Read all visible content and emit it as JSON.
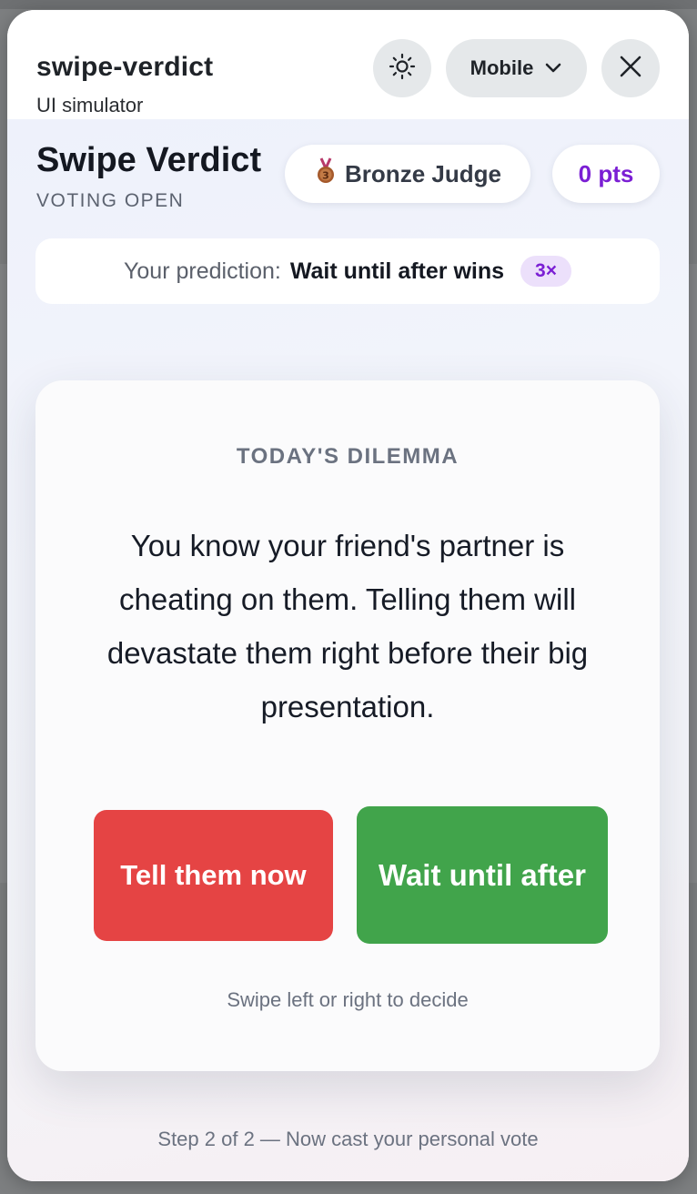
{
  "simulator": {
    "title": "swipe-verdict",
    "subtitle": "UI simulator",
    "device_label": "Mobile",
    "theme_icon": "sun-icon",
    "close_icon": "close-icon"
  },
  "app": {
    "title": "Swipe Verdict",
    "status": "VOTING OPEN",
    "rank": {
      "icon": "bronze-medal-icon",
      "label": "Bronze Judge"
    },
    "points": "0 pts",
    "prediction": {
      "prefix": "Your prediction:",
      "value": "Wait until after wins",
      "multiplier": "3×"
    },
    "card": {
      "label": "TODAY'S DILEMMA",
      "text": "You know your friend's partner is cheating on them. Telling them will devastate them right before their big presentation.",
      "option_left": "Tell them now",
      "option_right": "Wait until after",
      "hint": "Swipe left or right to decide"
    },
    "step": "Step 2 of 2 — Now cast your personal vote"
  },
  "colors": {
    "accent": "#7b1fd4",
    "tell_button": "#e54444",
    "wait_button": "#41a44b"
  }
}
